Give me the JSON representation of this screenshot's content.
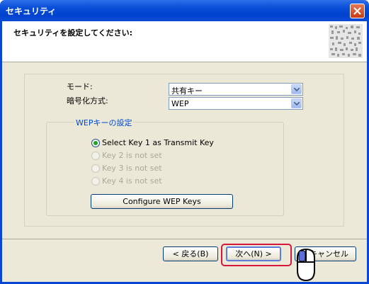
{
  "window": {
    "title": "セキュリティ"
  },
  "header": {
    "title": "セキュリティを設定してください:"
  },
  "mode": {
    "label": "モード:",
    "value": "共有キー"
  },
  "encryption": {
    "label": "暗号化方式:",
    "value": "WEP"
  },
  "wep_group": {
    "title": "WEPキーの設定",
    "keys": [
      {
        "label": "Select Key 1 as Transmit Key",
        "selected": true,
        "enabled": true
      },
      {
        "label": "Key 2 is not set",
        "selected": false,
        "enabled": false
      },
      {
        "label": "Key 3 is not set",
        "selected": false,
        "enabled": false
      },
      {
        "label": "Key 4 is not set",
        "selected": false,
        "enabled": false
      }
    ],
    "configure_label": "Configure WEP Keys"
  },
  "footer": {
    "back_label": "< 戻る(B)",
    "next_label": "次へ(N) >",
    "cancel_label": "キャンセル"
  },
  "colors": {
    "title_bar": "#0a4fd8",
    "highlight": "#d6163a",
    "dialog": "#ece9d8",
    "group_title": "#0046d5"
  },
  "icons": [
    "close-icon",
    "dropdown-arrow-icon",
    "mouse-pointer-icon",
    "qr-code-icon"
  ]
}
